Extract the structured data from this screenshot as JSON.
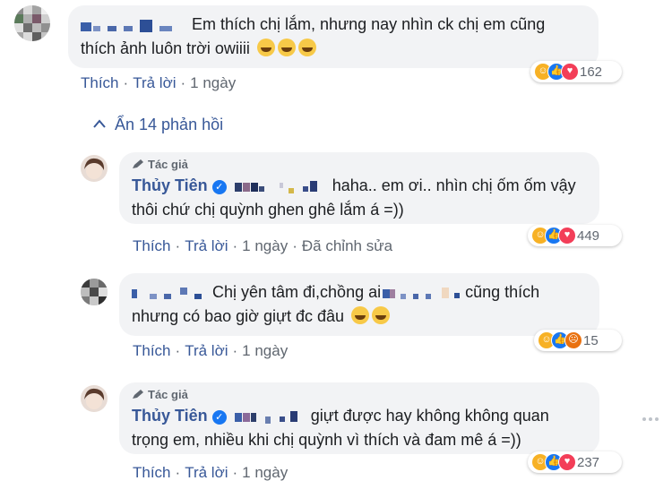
{
  "thread": {
    "toggle_label": "Ẩn 14 phản hồi"
  },
  "comments": [
    {
      "author_badge": "",
      "author": "",
      "text_line1": "Em thích chị lắm, nhưng nay nhìn ck chị em cũng",
      "text_line2": "thích ảnh luôn trời owiiii",
      "actions": {
        "like": "Thích",
        "reply": "Trả lời",
        "time": "1 ngày",
        "edited": ""
      },
      "reactions": {
        "icons": [
          "haha",
          "like",
          "love"
        ],
        "count": "162"
      }
    },
    {
      "author_badge": "Tác giả",
      "author": "Thủy Tiên",
      "text_line1": "haha.. em ơi.. nhìn chị ốm ốm vậy",
      "text_line2": "thôi chứ chị quỳnh ghen ghê lắm á =))",
      "actions": {
        "like": "Thích",
        "reply": "Trả lời",
        "time": "1 ngày",
        "edited": "Đã chỉnh sửa"
      },
      "reactions": {
        "icons": [
          "haha",
          "like",
          "love"
        ],
        "count": "449"
      }
    },
    {
      "author_badge": "",
      "author": "",
      "text_line1_a": "Chị yên tâm đi,chồng ai",
      "text_line1_b": "cũng thích",
      "text_line2": "nhưng có bao giờ giựt đc đâu",
      "actions": {
        "like": "Thích",
        "reply": "Trả lời",
        "time": "1 ngày",
        "edited": ""
      },
      "reactions": {
        "icons": [
          "haha",
          "like",
          "angry"
        ],
        "count": "15"
      }
    },
    {
      "author_badge": "Tác giả",
      "author": "Thủy Tiên",
      "text_line1": "giựt được hay không không quan",
      "text_line2": "trọng em, nhiều khi chị quỳnh vì thích và đam mê á =))",
      "actions": {
        "like": "Thích",
        "reply": "Trả lời",
        "time": "1 ngày",
        "edited": ""
      },
      "reactions": {
        "icons": [
          "haha",
          "like",
          "love"
        ],
        "count": "237"
      }
    }
  ],
  "colors": {
    "link": "#385898",
    "bubble": "#f2f3f5",
    "muted": "#606770"
  },
  "icons": [
    "pen-icon",
    "verified-icon",
    "chevron-up-icon",
    "more-icon"
  ]
}
